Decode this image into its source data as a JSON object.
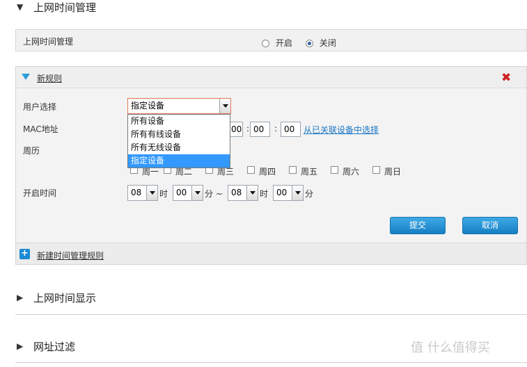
{
  "sections": {
    "time_mgmt": "上网时间管理",
    "time_display": "上网时间显示",
    "url_filter": "网址过滤"
  },
  "toggle_row": {
    "label": "上网时间管理",
    "options": [
      "开启",
      "关闭"
    ],
    "selected": "关闭"
  },
  "rule_panel": {
    "title": "新规则",
    "user_select_label": "用户选择",
    "user_select_value": "指定设备",
    "mac_label": "MAC地址",
    "mac_parts": [
      "00",
      "00",
      "00"
    ],
    "mac_link": "从已关联设备中选择",
    "calendar_label": "周历",
    "days": [
      "周一",
      "周二",
      "周三",
      "周四",
      "周五",
      "周六",
      "周日"
    ],
    "time_label": "开启时间",
    "start_hour": "08",
    "start_min": "00",
    "end_hour": "08",
    "end_min": "00",
    "hour_unit": "时",
    "min_unit": "分",
    "min_unit_sep": "分 ~",
    "submit": "提交",
    "cancel": "取消"
  },
  "dropdown_options": [
    "所有设备",
    "所有有线设备",
    "所有无线设备",
    "指定设备"
  ],
  "dropdown_highlight": "指定设备",
  "new_rule_link": "新建时间管理规则",
  "watermark": "值 什么值得买"
}
